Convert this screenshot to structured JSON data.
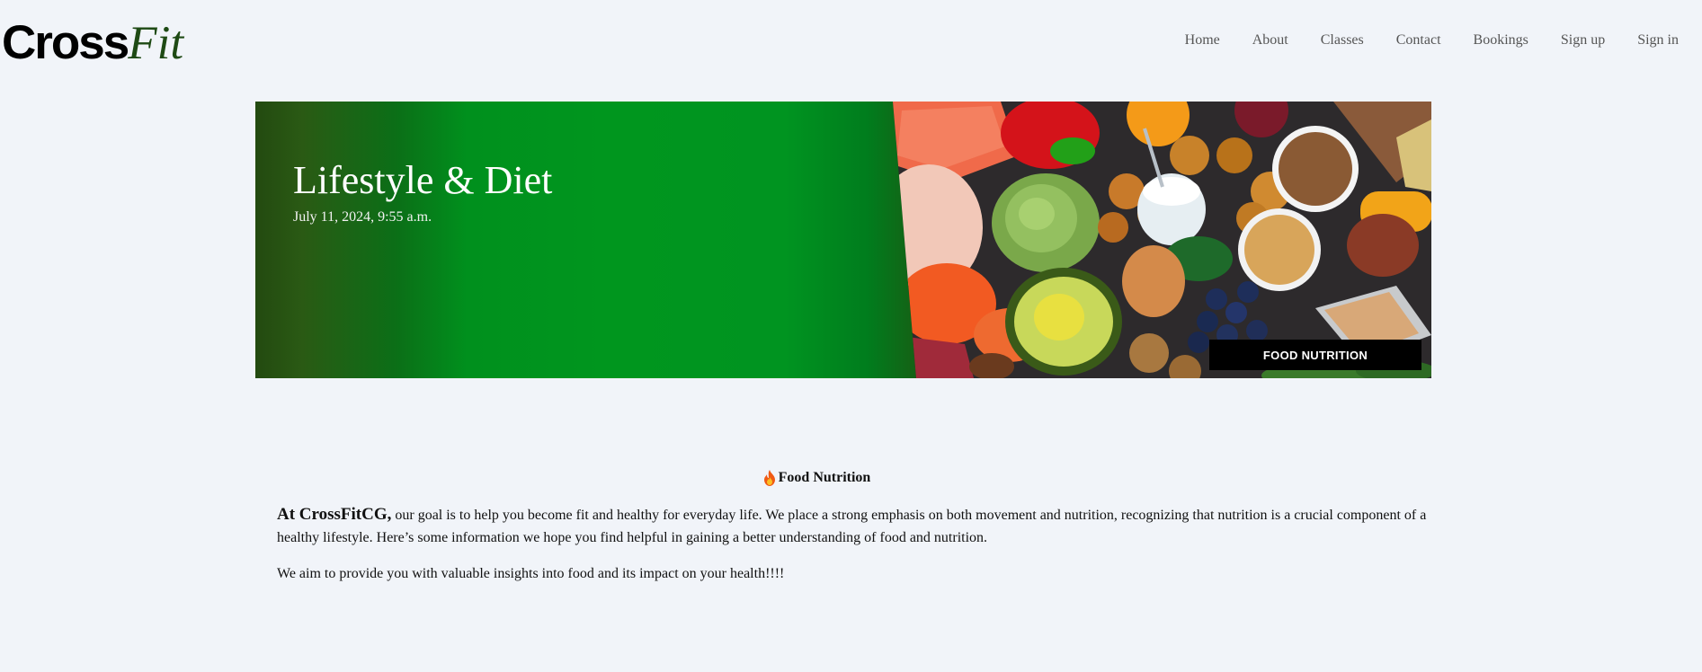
{
  "header": {
    "logo": {
      "part1": "Cross",
      "part2": "Fit"
    },
    "nav": [
      {
        "label": "Home"
      },
      {
        "label": "About"
      },
      {
        "label": "Classes"
      },
      {
        "label": "Contact"
      },
      {
        "label": "Bookings"
      },
      {
        "label": "Sign up"
      },
      {
        "label": "Sign in"
      }
    ]
  },
  "hero": {
    "title": "Lifestyle & Diet",
    "date": "July 11, 2024, 9:55 a.m.",
    "image_label": "FOOD NUTRITION"
  },
  "content": {
    "heading_icon": "fire-icon",
    "heading": "Food Nutrition",
    "intro_lead": "At CrossFitCG,",
    "intro_text": " our goal is to help you become fit and healthy for everyday life. We place a strong emphasis on both movement and nutrition, recognizing that nutrition is a crucial component of a healthy lifestyle. Here’s some information we hope you find helpful in gaining a better understanding of food and nutrition.",
    "paragraph2": "We aim to provide you with valuable insights into food and its impact on your health!!!!"
  },
  "colors": {
    "background": "#f1f4f9",
    "logo_fit": "#1e4a14",
    "hero_green": "#00961e",
    "hero_dark": "#254a10"
  }
}
